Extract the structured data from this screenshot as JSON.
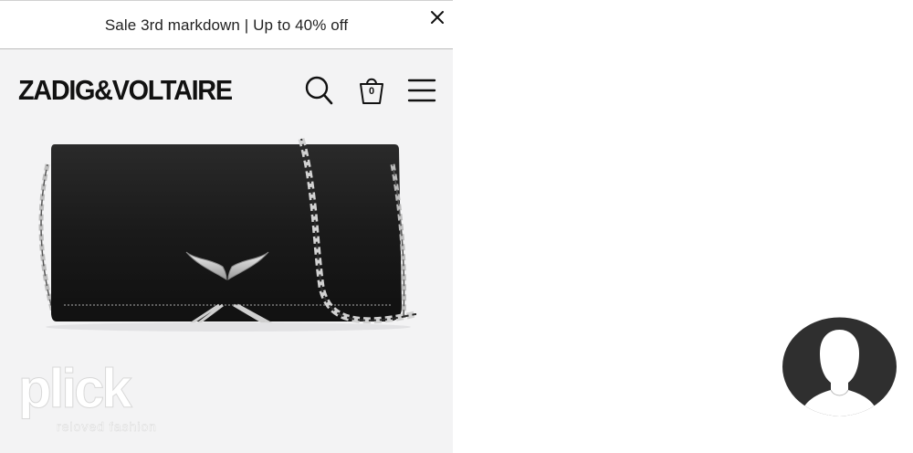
{
  "promo_bar": {
    "text": "Sale 3rd markdown | Up to 40% off",
    "close_icon": "close-icon"
  },
  "header": {
    "logo_text": "ZADIG&VOLTAIRE",
    "search_icon": "search-icon",
    "bag_icon": "shopping-bag-icon",
    "bag_count": "0",
    "menu_icon": "hamburger-menu-icon"
  },
  "product": {
    "image": "black leather clutch bag with silver chain strap and wing emblem"
  },
  "watermark": {
    "brand": "plick",
    "tagline": "reloved fashion"
  },
  "profile": {
    "avatar_icon": "user-avatar-icon"
  },
  "colors": {
    "page_bg": "#ffffff",
    "content_bg": "#f3f3f4",
    "text": "#111111",
    "bag_leather": "#1c1c1c",
    "chain_silver": "#c9c9c9",
    "avatar_bg": "#2f2f2f"
  }
}
